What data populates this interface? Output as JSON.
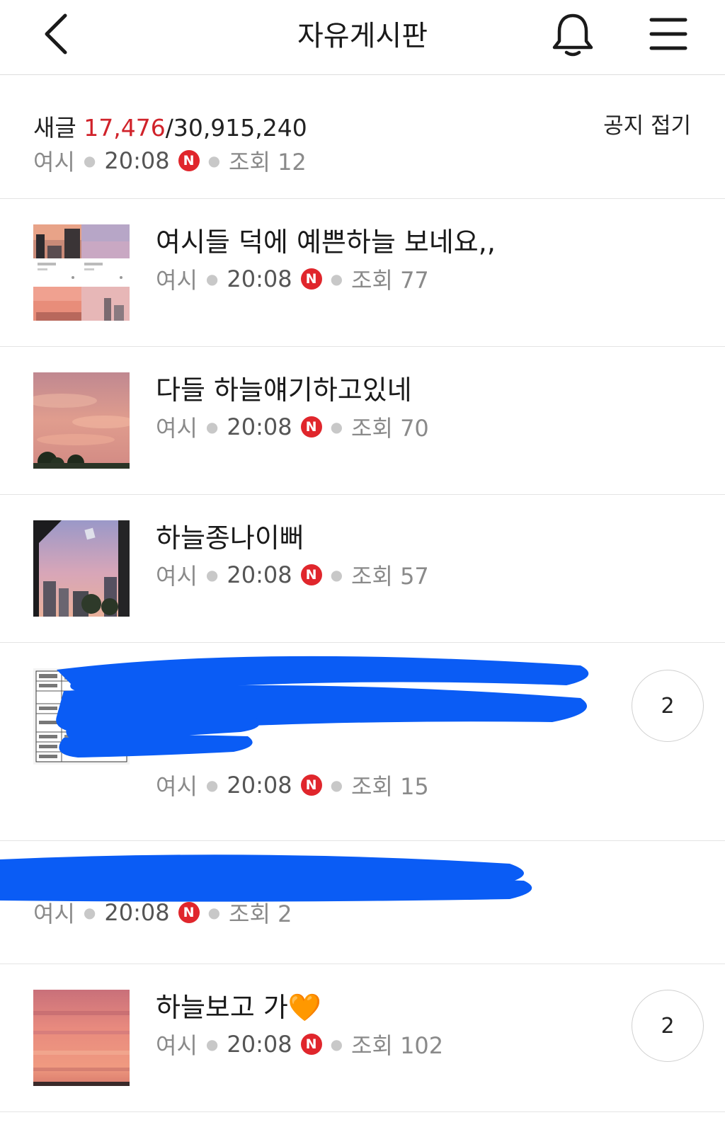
{
  "header": {
    "title": "자유게시판",
    "back_icon": "chevron-left-icon",
    "bell_icon": "bell-icon",
    "menu_icon": "hamburger-menu-icon"
  },
  "notice": {
    "label": "새글",
    "new_count": "17,476",
    "total": "/30,915,240",
    "toggle": "공지 접기",
    "author": "여시",
    "time": "20:08",
    "badge": "N",
    "views": "조회 12"
  },
  "posts": [
    {
      "title": "여시들 덕에 예쁜하늘 보네요,,",
      "author": "여시",
      "time": "20:08",
      "badge": "N",
      "views": "조회 77"
    },
    {
      "title": "다들 하늘얘기하고있네",
      "author": "여시",
      "time": "20:08",
      "badge": "N",
      "views": "조회 70"
    },
    {
      "title": "하늘종나이뻐",
      "author": "여시",
      "time": "20:08",
      "badge": "N",
      "views": "조회 57"
    },
    {
      "title": "",
      "author": "여시",
      "time": "20:08",
      "badge": "N",
      "views": "조회 15",
      "comments": "2"
    },
    {
      "title": "",
      "author": "여시",
      "time": "20:08",
      "badge": "N",
      "views": "조회 2"
    },
    {
      "title": "하늘보고 가",
      "emoji": "🧡",
      "author": "여시",
      "time": "20:08",
      "badge": "N",
      "views": "조회 102",
      "comments": "2"
    }
  ],
  "colors": {
    "accent_red": "#d0222a",
    "badge_red": "#e0262c",
    "redaction_blue": "#0a5cf5"
  }
}
